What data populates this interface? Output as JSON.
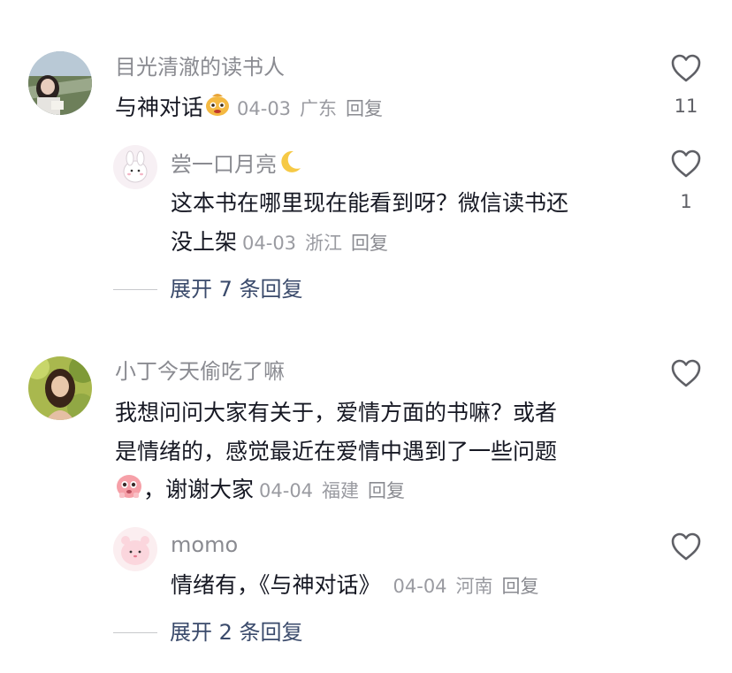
{
  "comments": [
    {
      "username": "目光清澈的读书人",
      "text": "与神对话",
      "date": "04-03",
      "location": "广东",
      "reply_label": "回复",
      "likes": "11",
      "emoji": "money-bag-face-emoji",
      "replies": [
        {
          "username": "尝一口月亮",
          "username_emoji": "crescent-moon-emoji",
          "text_line1": "这本书在哪里现在能看到呀？微信读书还",
          "text_line2": "没上架",
          "date": "04-03",
          "location": "浙江",
          "reply_label": "回复",
          "likes": "1"
        }
      ],
      "expand_label": "展开 7 条回复"
    },
    {
      "username": "小丁今天偷吃了嘛",
      "text_line1": "我想问问大家有关于，爱情方面的书嘛？或者",
      "text_line2": "是情绪的，感觉最近在爱情中遇到了一些问题",
      "text_line3": "，谢谢大家",
      "date": "04-04",
      "location": "福建",
      "reply_label": "回复",
      "likes": "",
      "emoji": "pleading-face-emoji",
      "replies": [
        {
          "username": "momo",
          "text": "情绪有，《与神对话》",
          "date": "04-04",
          "location": "河南",
          "reply_label": "回复",
          "likes": ""
        }
      ],
      "expand_label": "展开 2 条回复"
    }
  ],
  "colors": {
    "text": "#161823",
    "secondary": "#8a8b91",
    "expand": "#3a4a6b"
  }
}
